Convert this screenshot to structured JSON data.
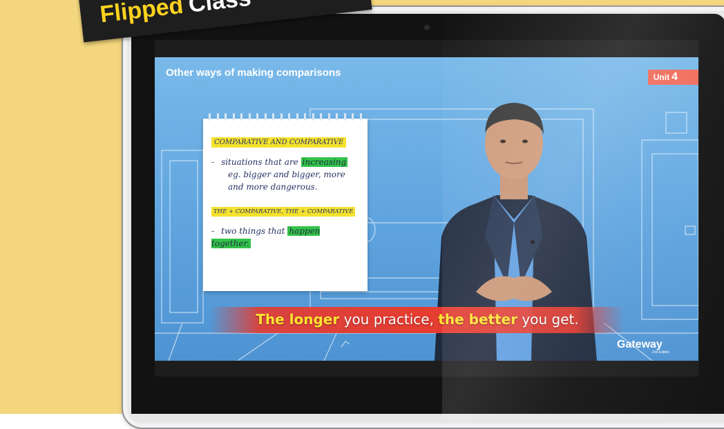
{
  "badge": {
    "word1": "Flipped",
    "word2": "Class"
  },
  "video": {
    "title": "Other ways of making comparisons",
    "unit_label": "Unit",
    "unit_number": "4",
    "brand": "Gateway",
    "brand_sub": "2nd Edition"
  },
  "notepad": {
    "heading1": "COMPARATIVE AND COMPARATIVE",
    "line1_dash": "-",
    "line1_a": "situations that are",
    "line1_hl": "increasing",
    "line2": "eg. bigger and bigger, more",
    "line3": "and more dangerous.",
    "heading2": "THE + COMPARATIVE, THE + COMPARATIVE",
    "line4_dash": "-",
    "line4_a": "two things that",
    "line4_hl": "happen together."
  },
  "subtitle": {
    "part1": "The longer",
    "part2": " you practice, ",
    "part3": "the better",
    "part4": " you get."
  },
  "colors": {
    "background": "#f4d67e",
    "badge": "#1e1e1e",
    "badge_text": "#ffd21f",
    "screen_blue": "#5fa4df",
    "subtitle_band": "#e63c30",
    "highlight_yellow": "#f4e22f",
    "highlight_green": "#33c34a"
  }
}
